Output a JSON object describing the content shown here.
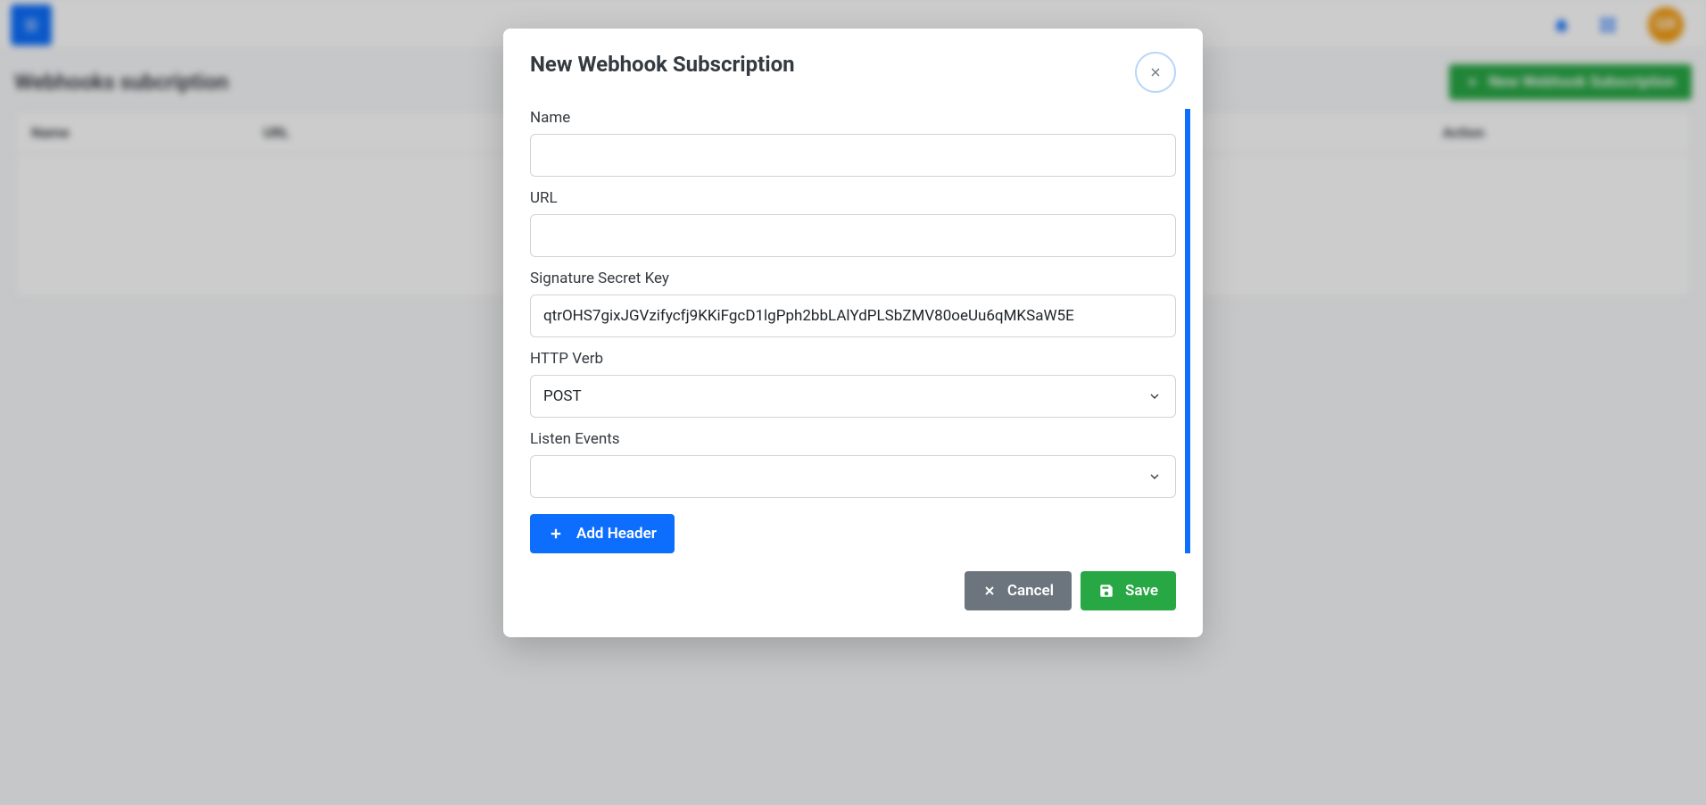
{
  "topbar": {
    "avatar_initials": "GR"
  },
  "background_page": {
    "title": "Webhooks subcription",
    "new_button_label": "New Webhook Subscription",
    "columns": {
      "name": "Name",
      "url": "URL",
      "action": "Action"
    }
  },
  "modal": {
    "title": "New Webhook Subscription",
    "fields": {
      "name": {
        "label": "Name",
        "value": ""
      },
      "url": {
        "label": "URL",
        "value": ""
      },
      "signature": {
        "label": "Signature Secret Key",
        "value": "qtrOHS7gixJGVzifycfj9KKiFgcD1lgPph2bbLAlYdPLSbZMV80oeUu6qMKSaW5E"
      },
      "http_verb": {
        "label": "HTTP Verb",
        "value": "POST"
      },
      "listen_events": {
        "label": "Listen Events",
        "value": ""
      }
    },
    "add_header_label": "Add Header",
    "footer": {
      "cancel": "Cancel",
      "save": "Save"
    }
  }
}
